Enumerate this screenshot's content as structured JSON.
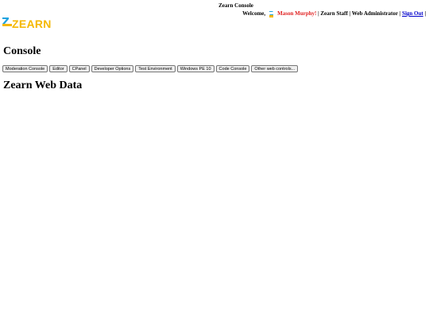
{
  "header": {
    "page_title": "Zearn Console",
    "welcome_label": "Welcome,",
    "user_name": "Mason Murphy!",
    "separator_1": "|",
    "role_staff": "Zearn Staff",
    "separator_2": "|",
    "role_admin": "Web Administrator",
    "separator_3": "|",
    "sign_out_label": "Sign Out",
    "separator_4": "|"
  },
  "logo": {
    "text": "ZEARN",
    "colors": {
      "yellow": "#f5b800",
      "blue": "#1fa3e0"
    }
  },
  "main": {
    "console_heading": "Console",
    "buttons": [
      "Moderation Console",
      "Editor",
      "CPanel",
      "Developer Options",
      "Test Environment",
      "Windows PE 10",
      "Code Console",
      "Other web controls..."
    ],
    "web_data_heading": "Zearn Web Data"
  },
  "colors": {
    "user_name": "#e02020",
    "link": "#0000cc"
  }
}
